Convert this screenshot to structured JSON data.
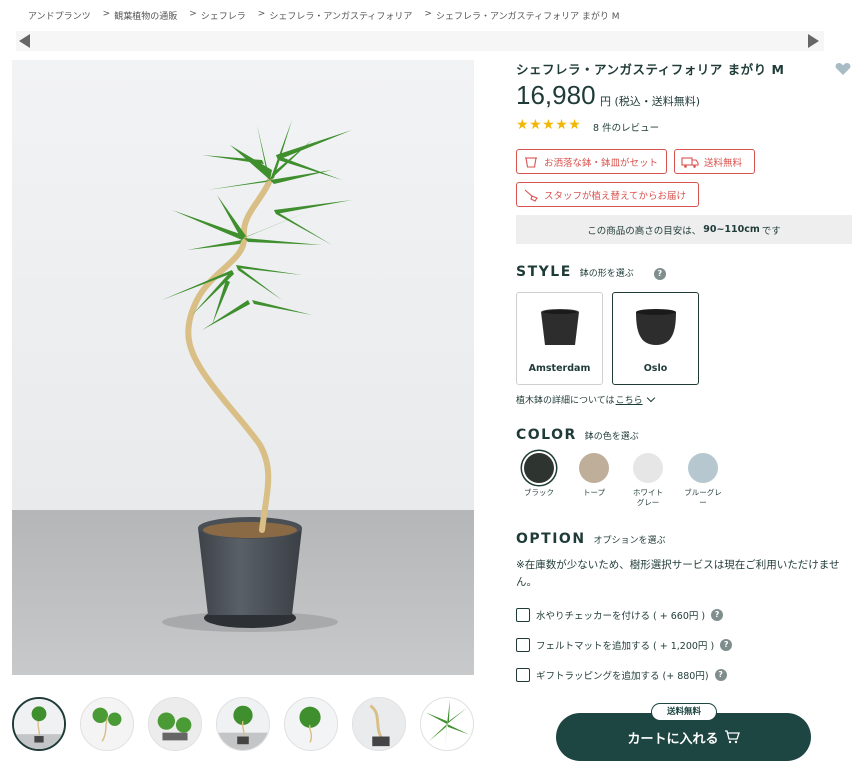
{
  "breadcrumb": {
    "items": [
      "アンドプランツ",
      "観葉植物の通販",
      "シェフレラ",
      "シェフレラ・アンガスティフォリア",
      "シェフレラ・アンガスティフォリア まがり M"
    ],
    "separator": ">"
  },
  "product": {
    "title": "シェフレラ・アンガスティフォリア まがり M",
    "price": "16,980",
    "price_suffix": "円 (税込・送料無料)",
    "rating": 5,
    "review_text": "8 件のレビュー"
  },
  "tags": [
    "お洒落な鉢・鉢皿がセット",
    "送料無料",
    "スタッフが植え替えてからお届け"
  ],
  "height_note": {
    "prefix": "この商品の高さの目安は、",
    "value": "90~110cm",
    "suffix": "です"
  },
  "style_section": {
    "title": "STYLE",
    "subtitle": "鉢の形を選ぶ",
    "help": "?",
    "options": [
      {
        "label": "Amsterdam",
        "selected": false
      },
      {
        "label": "Oslo",
        "selected": true
      }
    ],
    "link_prefix": "植木鉢の詳細については",
    "link_text": "こちら"
  },
  "color_section": {
    "title": "COLOR",
    "subtitle": "鉢の色を選ぶ",
    "swatches": [
      {
        "label": "ブラック",
        "color": "#2e3430",
        "selected": true
      },
      {
        "label": "トープ",
        "color": "#bfae9a",
        "selected": false
      },
      {
        "label": "ホワイトグレー",
        "color": "#e6e6e6",
        "selected": false
      },
      {
        "label": "ブルーグレー",
        "color": "#b6c7cf",
        "selected": false
      }
    ]
  },
  "option_section": {
    "title": "OPTION",
    "subtitle": "オプションを選ぶ",
    "note": "※在庫数が少ないため、樹形選択サービスは現在ご利用いただけません。",
    "items": [
      "水やりチェッカーを付ける ( + 660円 )",
      "フェルトマットを追加する ( + 1,200円 )",
      "ギフトラッピングを追加する (+ 880円)"
    ],
    "help": "?"
  },
  "cart": {
    "label": "カートに入れる",
    "badge": "送料無料"
  },
  "colors": {
    "primary": "#1d4541",
    "accent_red": "#d9534f",
    "star": "#f2b705"
  }
}
